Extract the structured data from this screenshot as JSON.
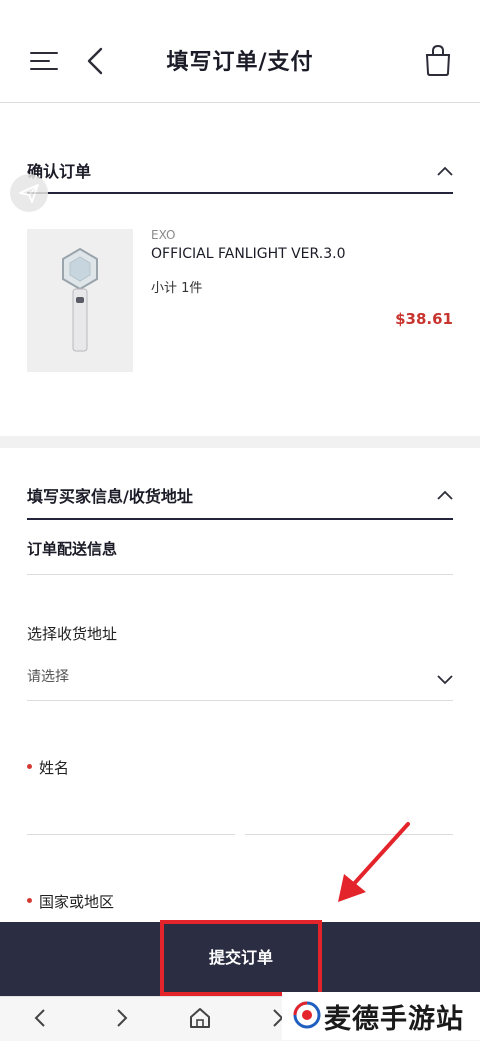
{
  "header": {
    "title": "填写订单/支付",
    "menu_icon": "hamburger-menu-icon",
    "back_icon": "chevron-left-icon",
    "bag_icon": "shopping-bag-icon"
  },
  "confirm_section": {
    "title": "确认订单",
    "toggle_icon": "chevron-up-icon"
  },
  "product": {
    "brand": "EXO",
    "name": "OFFICIAL FANLIGHT VER.3.0",
    "quantity": "小计 1件",
    "price": "$38.61"
  },
  "buyer_section": {
    "title": "填写买家信息/收货地址",
    "subtitle": "订单配送信息",
    "address_label": "选择收货地址",
    "address_value": "请选择",
    "name_label": "姓名",
    "country_label": "国家或地区"
  },
  "submit": {
    "label": "提交订单"
  },
  "watermark": {
    "text": "麦德手游站"
  },
  "colors": {
    "accent_dark": "#2b2d42",
    "price_red": "#c8342e",
    "highlight_red": "#e3242b"
  }
}
